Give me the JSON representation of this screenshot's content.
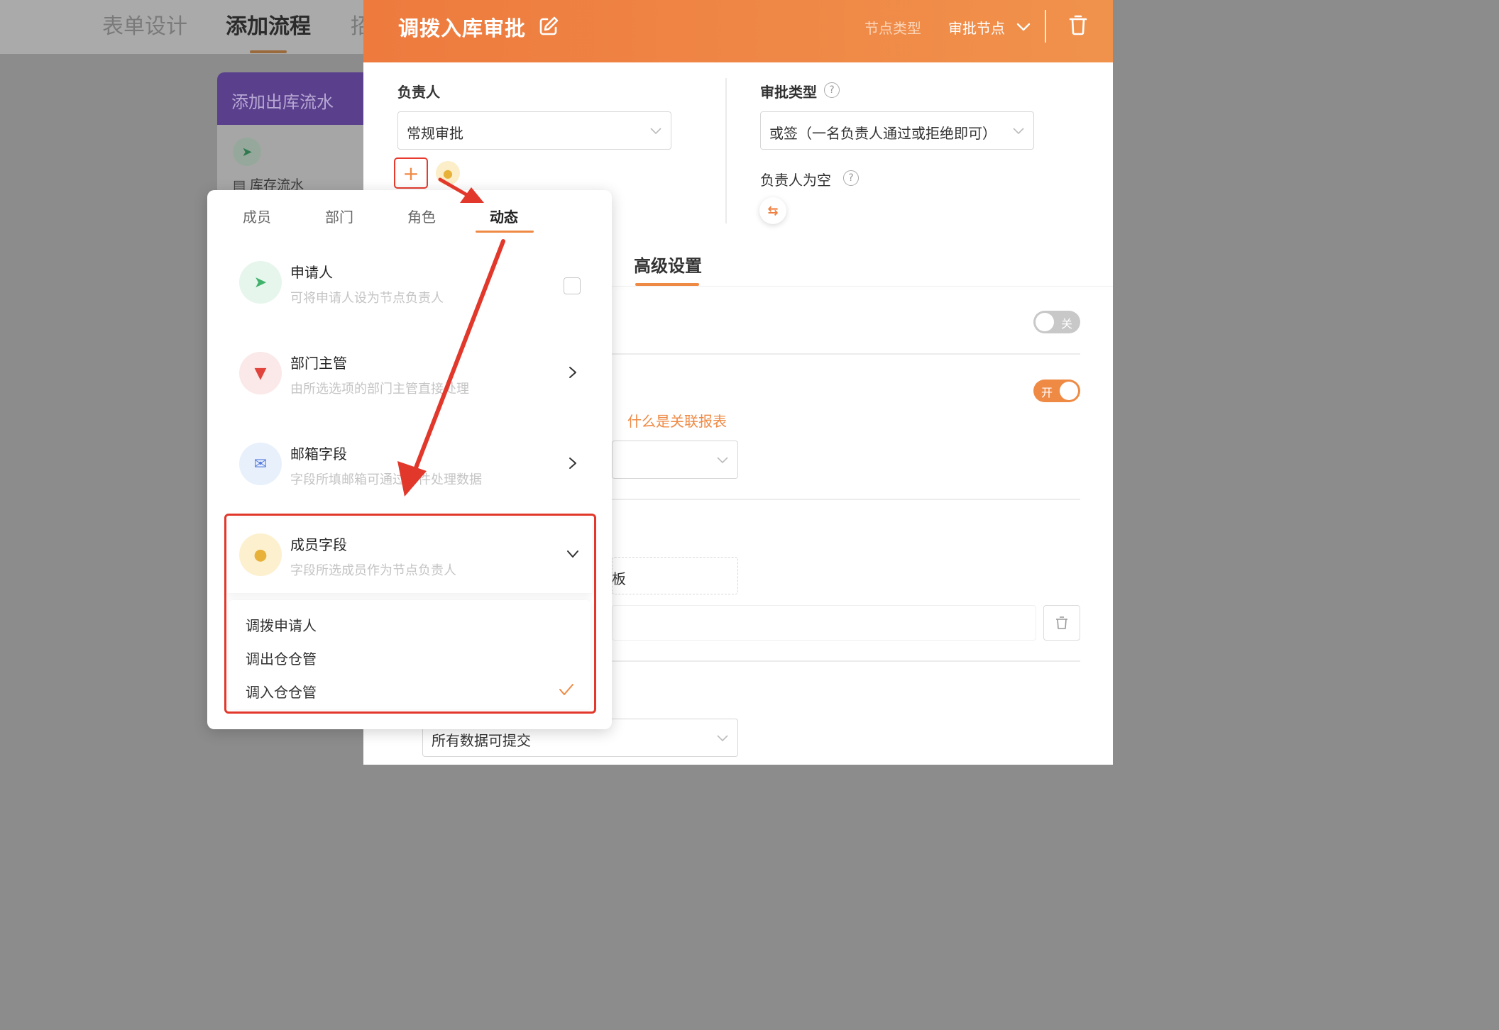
{
  "background": {
    "tabs": [
      "表单设计",
      "添加流程",
      "招"
    ],
    "card_title": "添加出库流水",
    "card_item": "库存流水"
  },
  "drawer": {
    "title": "调拨入库审批",
    "node_type_label": "节点类型",
    "node_type_value": "审批节点",
    "owner_label": "负责人",
    "owner_select": "常规审批",
    "approval_type_label": "审批类型",
    "approval_type_select": "或签（一名负责人通过或拒绝即可）",
    "empty_owner_label": "负责人为空",
    "advanced_tab": "高级设置",
    "toggle_off_label": "关",
    "toggle_on_label": "开",
    "partial_char": "：",
    "link_text": "什么是关联报表",
    "dashed_partial": "板",
    "bottom_select": "所有数据可提交"
  },
  "popup": {
    "tabs": [
      "成员",
      "部门",
      "角色",
      "动态"
    ],
    "active_tab": "动态",
    "options": [
      {
        "title": "申请人",
        "desc": "可将申请人设为节点负责人"
      },
      {
        "title": "部门主管",
        "desc": "由所选选项的部门主管直接处理"
      },
      {
        "title": "邮箱字段",
        "desc": "字段所填邮箱可通过邮件处理数据"
      },
      {
        "title": "成员字段",
        "desc": "字段所选成员作为节点负责人"
      }
    ],
    "member_fields": [
      "调拨申请人",
      "调出仓仓管",
      "调入仓仓管"
    ],
    "selected_member_field": "调入仓仓管"
  },
  "colors": {
    "accent": "#ef8a45",
    "header_start": "#ee7a3e",
    "annotation_red": "#e2382b"
  }
}
